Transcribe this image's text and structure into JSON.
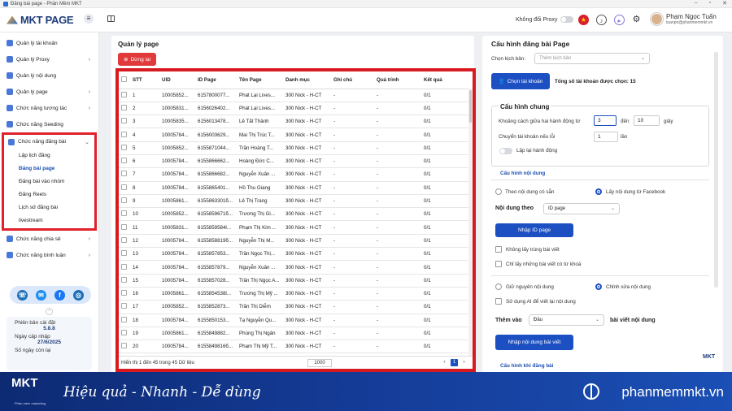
{
  "window": {
    "title": "Đăng bài page - Phần Mềm MKT"
  },
  "header": {
    "logo_text": "MKT PAGE",
    "proxy_label": "Không đổi Proxy",
    "user_name": "Phạm Ngọc Tuấn",
    "user_email": "tuanpn@phanmemmkt.vn"
  },
  "sidebar": {
    "items": [
      {
        "label": "Quản lý tài khoản"
      },
      {
        "label": "Quản lý Proxy"
      },
      {
        "label": "Quản lý nội dung"
      },
      {
        "label": "Quản lý page"
      },
      {
        "label": "Chức năng tương tác"
      },
      {
        "label": "Chức năng Seeding"
      },
      {
        "label": "Chức năng đăng bài"
      },
      {
        "label": "Chức năng chia sẻ"
      },
      {
        "label": "Chức năng bình luận"
      }
    ],
    "sub_items": [
      {
        "label": "Lập lịch đăng"
      },
      {
        "label": "Đăng bài page"
      },
      {
        "label": "Đăng bài vào nhóm"
      },
      {
        "label": "Đăng Reels"
      },
      {
        "label": "Lịch sử đăng bài"
      },
      {
        "label": "livestream"
      }
    ],
    "version_label": "Phiên bản cài đặt",
    "version": "5.8.8",
    "update_label": "Ngày cập nhập",
    "update_date": "27/6/2025",
    "days_left_label": "Số ngày còn lại"
  },
  "left_panel": {
    "title": "Quản lý page",
    "stop_button": "Dừng lại",
    "columns": [
      "STT",
      "UID",
      "ID Page",
      "Tên Page",
      "Danh mục",
      "Ghi chú",
      "Quá trình",
      "Kết quả"
    ],
    "rows": [
      [
        "1",
        "10005852...",
        "6157800077...",
        "Phát Lại Lives...",
        "300 Nick - H-CT",
        "-",
        "-",
        "0/1"
      ],
      [
        "2",
        "10005831...",
        "6156026402...",
        "Phát Lại Lives...",
        "300 Nick - H-CT",
        "-",
        "-",
        "0/1"
      ],
      [
        "3",
        "10005835...",
        "6156013478...",
        "Lê Tất Thành",
        "300 Nick - H-CT",
        "-",
        "-",
        "0/1"
      ],
      [
        "4",
        "10005784...",
        "6156003629...",
        "Mai Thị Trúc T...",
        "300 Nick - H-CT",
        "-",
        "-",
        "0/1"
      ],
      [
        "5",
        "10005852...",
        "6155871044...",
        "Trần Hoàng T...",
        "300 Nick - H-CT",
        "-",
        "-",
        "0/1"
      ],
      [
        "6",
        "10005784...",
        "6155866662...",
        "Hoàng Đức C...",
        "300 Nick - H-CT",
        "-",
        "-",
        "0/1"
      ],
      [
        "7",
        "10005784...",
        "6155866682...",
        "Nguyễn Xuân ...",
        "300 Nick - H-CT",
        "-",
        "-",
        "0/1"
      ],
      [
        "8",
        "10005784...",
        "6155865401...",
        "Hồ Thu Giang",
        "300 Nick - H-CT",
        "-",
        "-",
        "0/1"
      ],
      [
        "9",
        "10005861...",
        "6155863301б...",
        "Lê Thị Trang",
        "300 Nick - H-CT",
        "-",
        "-",
        "0/1"
      ],
      [
        "10",
        "10005852...",
        "6155859671б...",
        "Trương Thị Gi...",
        "300 Nick - H-CT",
        "-",
        "-",
        "0/1"
      ],
      [
        "11",
        "10005831...",
        "6155859584l...",
        "Phạm Thị Kim ...",
        "300 Nick - H-CT",
        "-",
        "-",
        "0/1"
      ],
      [
        "12",
        "10005784...",
        "6155858819б...",
        "Nguyễn Thị M...",
        "300 Nick - H-CT",
        "-",
        "-",
        "0/1"
      ],
      [
        "13",
        "10005784...",
        "6155857853...",
        "Trần Ngọc Thị...",
        "300 Nick - H-CT",
        "-",
        "-",
        "0/1"
      ],
      [
        "14",
        "10005784...",
        "6155857879...",
        "Nguyễn Xuân ...",
        "300 Nick - H-CT",
        "-",
        "-",
        "0/1"
      ],
      [
        "15",
        "10005784...",
        "6155857028...",
        "Trần Thị Ngọc A...",
        "300 Nick - H-CT",
        "-",
        "-",
        "0/1"
      ],
      [
        "16",
        "10005861...",
        "6155854538l...",
        "Trương Thị Mỹ ...",
        "300 Nick - H-CT",
        "-",
        "-",
        "0/1"
      ],
      [
        "17",
        "10005852...",
        "6155852873...",
        "Trần Thị Diễm",
        "300 Nick - H-CT",
        "-",
        "-",
        "0/1"
      ],
      [
        "18",
        "10005784...",
        "6155850153...",
        "Tạ Nguyễn Qu...",
        "300 Nick - H-CT",
        "-",
        "-",
        "0/1"
      ],
      [
        "19",
        "10005861...",
        "6155849882...",
        "Phùng Thị Ngân",
        "300 Nick - H-CT",
        "-",
        "-",
        "0/1"
      ],
      [
        "20",
        "10005784...",
        "6155849816б...",
        "Phạm Thị Mỹ T...",
        "300 Nick - H-CT",
        "-",
        "-",
        "0/1"
      ]
    ],
    "footer_text": "Hiển thị 1 đến 45 trong 45 Dữ liệu",
    "page_size": "1000",
    "current_page": "1"
  },
  "right_panel": {
    "title": "Cấu hình đăng bài Page",
    "scenario_label": "Chọn kịch bản:",
    "scenario_placeholder": "Thêm kịch bản",
    "choose_account_btn": "Chọn tài khoản",
    "selected_accounts": "Tổng số tài khoản được chọn: 15",
    "general_config": "Cấu hình chung",
    "interval_label": "Khoảng cách giữa hai hành động từ",
    "interval_from": "3",
    "interval_to_label": "đến",
    "interval_to": "10",
    "interval_unit": "giây",
    "switch_label": "Chuyển tài khoản nếu lỗi",
    "switch_value": "1",
    "switch_unit": "lần",
    "repeat_label": "Lặp lại hành động",
    "content_config": "Cấu hình nội dung",
    "radio_available": "Theo nội dung có sẵn",
    "radio_facebook": "Lấy nội dung từ Facebook",
    "content_by_label": "Nội dung theo",
    "content_by_value": "ID page",
    "import_id_btn": "Nhập ID page",
    "no_duplicate": "Không lấy trùng bài viết",
    "keyword_only": "Chỉ lấy những bài viết có từ khoá",
    "keep_content": "Giữ nguyên nội dung",
    "edit_content": "Chỉnh sửa nội dung",
    "ai_rewrite": "Sử dụng AI để viết lại nội dung",
    "add_to_label": "Thêm vào",
    "add_to_value": "Đầu",
    "add_to_suffix": "bài viết nội dung",
    "import_content_btn": "Nhập nội dung bài viết",
    "post_config": "Cấu hình khi đăng bài",
    "mkt_mini": "MKT"
  },
  "banner": {
    "logo": "MKT",
    "logo_sub": "Phần mềm marketing",
    "slogan": "Hiệu quả - Nhanh  - Dễ dùng",
    "site": "phanmemmkt.vn"
  },
  "colors": {
    "accent": "#1c4fc2",
    "danger": "#e03a3a",
    "highlight": "#d71920",
    "banner": "#143a94"
  }
}
